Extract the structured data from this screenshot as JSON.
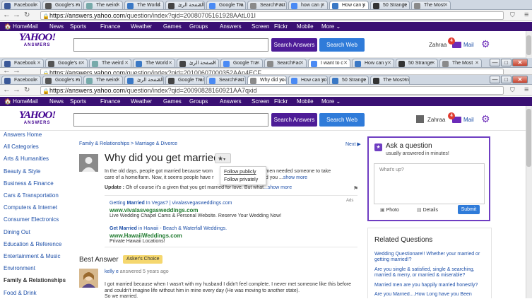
{
  "browser": {
    "tabs_top": [
      {
        "label": "Facebook",
        "icon": "facebook-icon"
      },
      {
        "label": "Google's m",
        "icon": "google-news-icon"
      },
      {
        "label": "The weird",
        "icon": "generic-page-icon"
      },
      {
        "label": "The World",
        "icon": "globe-icon"
      },
      {
        "label": "الصفحة الرئ",
        "icon": "bbc-icon"
      },
      {
        "label": "Google Tra",
        "icon": "google-translate-icon"
      },
      {
        "label": "SearchFact",
        "icon": "document-icon"
      },
      {
        "label": "how can y",
        "icon": "google-icon"
      },
      {
        "label": "How can y",
        "icon": "loading-icon",
        "active": true
      },
      {
        "label": "50 Strange",
        "icon": "circle-icon"
      },
      {
        "label": "The Most",
        "icon": "document-icon"
      }
    ],
    "tabs_mid": [
      {
        "label": "Facebook"
      },
      {
        "label": "Google's n"
      },
      {
        "label": "The weird"
      },
      {
        "label": "The World"
      },
      {
        "label": "الصفحة الرئ"
      },
      {
        "label": "Google Tra"
      },
      {
        "label": "SearchFac"
      },
      {
        "label": "I want to c",
        "active": true
      },
      {
        "label": "How can y"
      },
      {
        "label": "50 Strange"
      },
      {
        "label": "The Most"
      }
    ],
    "tabs_bottom": [
      {
        "label": "Facebook"
      },
      {
        "label": "Google's m"
      },
      {
        "label": "The weird"
      },
      {
        "label": "الصفحة الرئ"
      },
      {
        "label": "Google Trans"
      },
      {
        "label": "SearchFact"
      },
      {
        "label": "Why did you",
        "active": true
      },
      {
        "label": "How can yo"
      },
      {
        "label": "50 Strange"
      },
      {
        "label": "The Most In"
      }
    ],
    "url_top_host": "https://answers.yahoo.com",
    "url_top_path": "/question/index?qid=20080705161928AAtL01I",
    "url_mid_host": "https://answers.yahoo.com",
    "url_mid_path": "/question/index?qid=20100607000352AAn4ECF",
    "url_bottom_host": "https://answers.yahoo.com",
    "url_bottom_path": "/question/index?qid=20090828160921AA7qxid"
  },
  "yahoo": {
    "nav": [
      "Home",
      "Mail",
      "News",
      "Sports",
      "Finance",
      "Weather",
      "Games",
      "Groups",
      "Answers",
      "Screen",
      "Flickr",
      "Mobile",
      "More ⌄"
    ],
    "logo_top": "YAHOO!",
    "logo_sub": "ANSWERS",
    "search_answers": "Search Answers",
    "search_web": "Search Web",
    "user": "Zahraa",
    "mail_label": "Mail",
    "mail_count": "4"
  },
  "sidebar": [
    "Answers Home",
    "All Categories",
    "Arts & Humanities",
    "Beauty & Style",
    "Business & Finance",
    "Cars & Transportation",
    "Computers & Internet",
    "Consumer Electronics",
    "Dining Out",
    "Education & Reference",
    "Entertainment & Music",
    "Environment",
    "Family & Relationships",
    "Food & Drink"
  ],
  "question": {
    "breadcrumb": "Family & Relationships > Marriage & Divorce",
    "next": "Next ▶",
    "title": "Why did you get married?",
    "body_line1": "In the old days, people got married because wom",
    "body_line1b": "and men needed someone to take",
    "body_line2": "care of a home/farm. Now, it seems people have r",
    "body_line2b": "did you ...",
    "show_more": "show more",
    "update_label": "Update :",
    "update_text": "Oh of course it's a given that you get married for love. But what",
    "update_more": "...show more",
    "follow_publicly": "Follow publicly",
    "follow_privately": "Follow privately"
  },
  "ads": {
    "label": "Ads",
    "items": [
      {
        "title_pre": "Getting ",
        "title_bold": "Married",
        "title_post": " In Vegas? | vivalasvegasweddings.com",
        "url": "www.vivalasvegasweddings.com",
        "desc": "Live Wedding Chapel Cams & Personal Website. Reserve Your Wedding Now!"
      },
      {
        "title_pre": "",
        "title_bold": "Get Married",
        "title_post": " in Hawaii - Beach & Waterfall Weddings.",
        "url": "www.HawaiiWeddings.com",
        "desc": "Private Hawaii Locations!"
      }
    ]
  },
  "best_answer": {
    "heading": "Best Answer",
    "badge": "Asker's Choice",
    "author": "kelly e",
    "meta": " answered 5 years ago",
    "text1": "I got married because when I wasn't with my husband I didn't feel complete. I never met someone like this before",
    "text2": "and couldn't imagine life without him in mine every day (He was moving to another state).",
    "text3": "So we married."
  },
  "ask": {
    "title": "Ask a question",
    "sub": "usually answered in minutes!",
    "placeholder": "What's up?",
    "photo": "Photo",
    "details": "Details",
    "submit": "Submit"
  },
  "related": {
    "heading": "Related Questions",
    "items": [
      "Wedding Questionare!! Whether your married or getting married!?",
      "Are you single & satisfied, single & searching, married & merry, or married & miserable?",
      "Married men are you happily married honestly?",
      "Are you Married....How Long have you Been"
    ]
  },
  "colors": {
    "yahoo_purple": "#3a1073",
    "link_blue": "#1d4fa8",
    "ad_green": "#1f7a2e",
    "asker_badge": "#f5d76e"
  }
}
